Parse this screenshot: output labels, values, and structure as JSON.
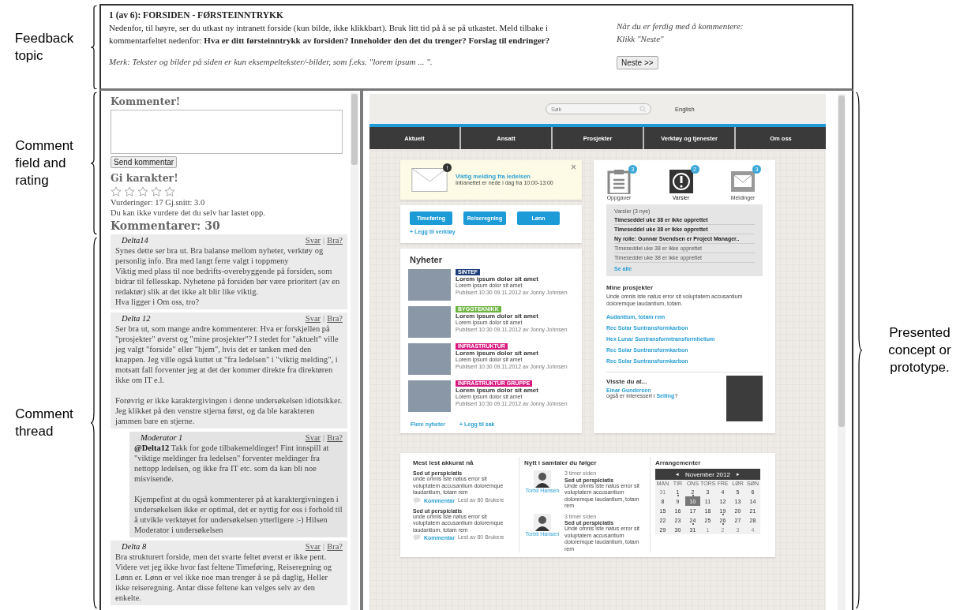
{
  "annotations": {
    "left": [
      "Feedback\ntopic",
      "Comment\nfield and\nrating",
      "Comment\nthread"
    ],
    "right": "Presented\nconcept or\nprototype."
  },
  "feedback_topic": {
    "title": "1 (av 6): FORSIDEN - FØRSTEINNTRYKK",
    "instructions": "Nedenfor, til høyre, ser du utkast ny intranett forside (kun bilde, ikke klikkbart). Bruk litt tid på å se på utkastet. Meld tilbake i kommentarfeltet nedenfor: **Hva er ditt førsteinntrykk av forsiden? Inneholder den det du trenger? Forslag til endringer?**",
    "note": "Merk: Tekster og bilder på siden er kun eksempeltekster/-bilder, som f.eks. \"lorem ipsum ... \".",
    "next_hint": "Når du er ferdig med å kommentere:\nKlikk \"Neste\"",
    "next_button": "Neste >>"
  },
  "comment_form": {
    "heading": "Kommenter!",
    "send_button": "Send kommentar"
  },
  "rating": {
    "heading": "Gi karakter!",
    "stars": 0,
    "summary": "Vurderinger: 17 Gj.snitt: 3.0",
    "notice": "Du kan ikke vurdere det du selv har lastet opp."
  },
  "comments": {
    "heading": "Kommentarer: 30",
    "items": [
      {
        "author": "Delta14",
        "reply_link": "Svar",
        "separator": "|",
        "like_link": "Bra?",
        "text": "Synes dette ser bra ut. Bra balanse mellom nyheter, verktøy og personlig info. Bra med langt ferre valgt i toppmeny\nViktig med plass til noe bedrifts-overebyggende på forsiden, som bidrar til fellesskap. Nyhetene på forsiden bør være prioritert (av en redaktør) slik at det ikke alt blir like viktig.\nHva ligger i Om oss, tro?"
      },
      {
        "author": "Delta 12",
        "reply_link": "Svar",
        "separator": "|",
        "like_link": "Bra?",
        "text": "Ser bra ut, som mange andre kommenterer. Hva er forskjellen på \"prosjekter\" øverst og \"mine prosjekter\"? I stedet for \"aktuelt\" ville jeg valgt \"forside\" eller \"hjem\", hvis det er tanken med den knappen. Jeg ville også kuttet ut \"fra ledelsen\" i \"viktig melding\", i motsatt fall forventer jeg at det der kommer direkte fra direktøren ikke om IT e.l.\n\nForøvrig er ikke karaktergivingen i denne undersøkelsen idiotsikker. Jeg klikket på den venstre stjerna først, og da ble karakteren jammen bare en stjerne.",
        "children": [
          {
            "author": "Moderator 1",
            "reply_link": "Svar",
            "separator": "|",
            "like_link": "Bra?",
            "text": "**@Delta12**   Takk for gode tilbakemeldinger! Fint innspill at \"viktige meldinger fra ledelsen\" forventer meldinger fra nettopp ledelsen, og ikke fra IT etc. som da kan bli noe misvisende.\n\nKjempefint at du også kommenterer på at karaktergivningen i undersøkelsen ikke er optimal, det er nyttig for oss i forhold til å utvikle verktøyet for undersøkelsen ytterligere :-) Hilsen Moderator i undersøkelsen"
          }
        ]
      },
      {
        "author": "Delta 8",
        "reply_link": "Svar",
        "separator": "|",
        "like_link": "Bra?",
        "text": "Bra strukturert forside, men det svarte feltet øverst er ikke pent. Videre vet jeg ikke hvor fast feltene Timeføring, Reiseregning og Lønn er. Lønn er vel ikke noe man trenger å se på daglig, Heller ikke reiseregning. Antar disse feltene kan velges selv av den enkelte."
      }
    ]
  },
  "prototype": {
    "search": {
      "placeholder": "Søk"
    },
    "language_link": "English",
    "nav": [
      "Aktuelt",
      "Ansatt",
      "Prosjekter",
      "Verktøy og tjenester",
      "Om oss"
    ],
    "notice": {
      "badge": "!",
      "title": "Viktig melding fra ledelsen",
      "text": "Intranettet er nede i dag fra 10:00-13:00",
      "close": "×"
    },
    "tools": {
      "buttons": [
        "Timeføring",
        "Reiseregning",
        "Lønn"
      ],
      "add_link": "+ Legg til verktøy"
    },
    "news": {
      "heading": "Nyheter",
      "items": [
        {
          "tag": "SINTEF",
          "color": "#1f3f7a",
          "title": "Lorem ipsum dolor sit amet",
          "summary": "Lorem ipsum dolor sit amet",
          "meta": "Publisert 10:30 09.11.2012 av Jonny Johnsen"
        },
        {
          "tag": "BYGGTEKNIKK",
          "color": "#6cb33f",
          "title": "Lorem ipsum dolor sit amet",
          "summary": "Lorem ipsum dolor sit amet",
          "meta": "Publisert 10:30 09.11.2012 av Jonny Johnsen"
        },
        {
          "tag": "INFRASTRUKTUR",
          "color": "#d6187f",
          "title": "Lorem ipsum dolor sit amet",
          "summary": "Lorem ipsum dolor sit amet",
          "meta": "Publisert 10:30 09.11.2012 av Jonny Johnsen"
        },
        {
          "tag": "INFRASTRUKTUR GRUPPE",
          "color": "#d6187f",
          "title": "Lorem ipsum dolor sit amet",
          "summary": "Lorem ipsum dolor sit amet",
          "meta": "Publisert 10:30 09.11.2012 av Jonny Johnsen"
        }
      ],
      "more_link": "Flere nyheter",
      "add_link": "+ Legg til sak"
    },
    "notification_tabs": [
      {
        "kind": "clipboard",
        "label": "Oppgaver",
        "badge": "3",
        "selected": false
      },
      {
        "kind": "alert",
        "label": "Varsler",
        "badge": "2",
        "selected": true
      },
      {
        "kind": "envelope",
        "label": "Meldinger",
        "badge": "3",
        "selected": false
      }
    ],
    "alerts": {
      "heading": "Varsler (3 nye)",
      "items": [
        {
          "text": "Timeseddel uke 38 er ikke opprettet",
          "unread": true
        },
        {
          "text": "Timeseddel uke 38 er ikke opprettet",
          "unread": true
        },
        {
          "text": "Ny rolle: Gunnar Svendsen er Project Manager..",
          "unread": true
        },
        {
          "text": "Timeseddel uke 38 er ikke opprettet",
          "unread": false
        },
        {
          "text": "Timeseddel uke 38 er ikke opprettet",
          "unread": false
        }
      ],
      "see_all": "Se alle"
    },
    "projects": {
      "heading": "Mine prosjekter",
      "description": "Unde omnis iste natus error sit voluptatem accusantium doloremque laudantium, totam.",
      "links": [
        "Audantium, totam rem",
        "Rec Solar Suntransformkarbon",
        "Hex Lunar Suntransformtransformhelium",
        "Rec Solar Suntransformkarbon",
        "Rec Solar Suntransformkarbon"
      ]
    },
    "did_you_know": {
      "heading": "Visste du at...",
      "person_link": "Einar Gundersen",
      "text": "også er interessert i ",
      "interest_link": "Seiling",
      "text_end": "?"
    },
    "most_read": {
      "heading": "Mest lest akkurat nå",
      "items": [
        {
          "title": "Sed ut perspiciatis",
          "text": "unde omnis iste natus error sit voluptatem accusantium doloremque laudantium, totam rem",
          "comment_link": "Kommentar",
          "meta": "Lest av 80 Brukere"
        },
        {
          "title": "Sed ut perspiciatis",
          "text": "unde omnis iste natus error sit voluptatem accusantium doloremque laudantium, totam rem",
          "comment_link": "Kommentar",
          "meta": "Lest av 80 Brukere"
        }
      ]
    },
    "conversations": {
      "heading": "Nytt i samtaler du følger",
      "items": [
        {
          "time": "3 timer siden",
          "person": "Torbil Hansen",
          "title": "Sed ut perspiciatis",
          "text": "Unde omnis iste natus error sit voluptatem accusantium doloremque laudantium, totam rem"
        },
        {
          "time": "3 timer siden",
          "person": "Torbil Hansen",
          "title": "Sed ut perspiciatis",
          "text": "Unde omnis iste natus error sit voluptatem accusantium doloremque laudantium, totam rem"
        }
      ]
    },
    "events": {
      "heading": "Arrangementer",
      "calendar": {
        "prev": "◂",
        "month": "November 2012",
        "next": "▸",
        "weekdays": [
          "MAN",
          "TIR",
          "ONS",
          "TORS",
          "FRE",
          "LØR",
          "SØN"
        ],
        "days": [
          {
            "label": "31",
            "other_month": true,
            "event": false,
            "selected": false
          },
          {
            "label": "1",
            "other_month": false,
            "event": true,
            "selected": false
          },
          {
            "label": "2",
            "other_month": false,
            "event": true,
            "selected": false
          },
          {
            "label": "3",
            "other_month": false,
            "event": false,
            "selected": false
          },
          {
            "label": "4",
            "other_month": false,
            "event": false,
            "selected": false
          },
          {
            "label": "5",
            "other_month": false,
            "event": false,
            "selected": false
          },
          {
            "label": "6",
            "other_month": false,
            "event": false,
            "selected": false
          },
          {
            "label": "8",
            "other_month": false,
            "event": false,
            "selected": false
          },
          {
            "label": "9",
            "other_month": false,
            "event": false,
            "selected": false
          },
          {
            "label": "10",
            "other_month": false,
            "event": false,
            "selected": true
          },
          {
            "label": "11",
            "other_month": false,
            "event": false,
            "selected": false
          },
          {
            "label": "12",
            "other_month": false,
            "event": false,
            "selected": false
          },
          {
            "label": "13",
            "other_month": false,
            "event": false,
            "selected": false
          },
          {
            "label": "14",
            "other_month": false,
            "event": false,
            "selected": false
          },
          {
            "label": "15",
            "other_month": false,
            "event": false,
            "selected": false
          },
          {
            "label": "16",
            "other_month": false,
            "event": false,
            "selected": false
          },
          {
            "label": "17",
            "other_month": false,
            "event": false,
            "selected": false
          },
          {
            "label": "18",
            "other_month": false,
            "event": false,
            "selected": false
          },
          {
            "label": "19",
            "other_month": false,
            "event": true,
            "selected": false
          },
          {
            "label": "20",
            "other_month": false,
            "event": false,
            "selected": false
          },
          {
            "label": "21",
            "other_month": false,
            "event": false,
            "selected": false
          },
          {
            "label": "22",
            "other_month": false,
            "event": false,
            "selected": false
          },
          {
            "label": "23",
            "other_month": false,
            "event": false,
            "selected": false
          },
          {
            "label": "24",
            "other_month": false,
            "event": true,
            "selected": false
          },
          {
            "label": "25",
            "other_month": false,
            "event": false,
            "selected": false
          },
          {
            "label": "26",
            "other_month": false,
            "event": true,
            "selected": false
          },
          {
            "label": "27",
            "other_month": false,
            "event": false,
            "selected": false
          },
          {
            "label": "28",
            "other_month": false,
            "event": false,
            "selected": false
          },
          {
            "label": "29",
            "other_month": false,
            "event": false,
            "selected": false
          },
          {
            "label": "30",
            "other_month": false,
            "event": false,
            "selected": false
          },
          {
            "label": "31",
            "other_month": false,
            "event": false,
            "selected": false
          },
          {
            "label": "1",
            "other_month": true,
            "event": false,
            "selected": false
          },
          {
            "label": "2",
            "other_month": true,
            "event": false,
            "selected": false
          },
          {
            "label": "3",
            "other_month": true,
            "event": false,
            "selected": false
          },
          {
            "label": "4",
            "other_month": true,
            "event": false,
            "selected": false
          }
        ]
      }
    }
  }
}
